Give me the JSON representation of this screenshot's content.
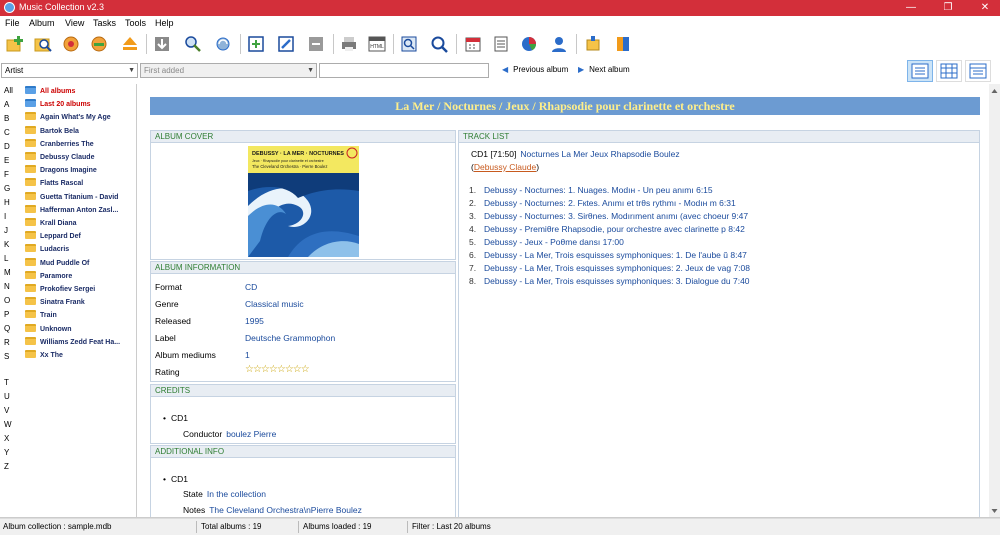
{
  "window": {
    "title": "Music Collection v2.3",
    "controls": [
      "—",
      "❐",
      "✕"
    ]
  },
  "menu": [
    "File",
    "Album",
    "View",
    "Tasks",
    "Tools",
    "Help"
  ],
  "toolbar": {
    "icons": [
      "add-album-icon",
      "search-icon",
      "edit-album-icon",
      "delete-album-icon",
      "eject-icon",
      "download-icon",
      "find-icon",
      "refresh-icon",
      "new-window-icon",
      "edit-icon",
      "collapse-icon",
      "printer-icon",
      "html-export-icon",
      "preview-icon",
      "zoom-icon",
      "calendar-icon",
      "list-icon",
      "pie-chart-icon",
      "user-icon",
      "plugin-icon",
      "book-icon"
    ]
  },
  "filter": {
    "group_by": "Artist",
    "sort_by": "First added",
    "search_value": "",
    "previous_label": "Previous album",
    "next_label": "Next album"
  },
  "letters": [
    "All",
    "A",
    "B",
    "C",
    "D",
    "E",
    "F",
    "G",
    "H",
    "I",
    "J",
    "K",
    "L",
    "M",
    "N",
    "O",
    "P",
    "Q",
    "R",
    "S",
    "T",
    "U",
    "V",
    "W",
    "X",
    "Y",
    "Z"
  ],
  "albums": [
    {
      "label": "All albums",
      "special": true
    },
    {
      "label": "Last 20 albums",
      "special": true
    },
    {
      "label": "Again What's My Age",
      "special": false
    },
    {
      "label": "Bartok Bela",
      "special": false
    },
    {
      "label": "Cranberries The",
      "special": false
    },
    {
      "label": "Debussy Claude",
      "special": false
    },
    {
      "label": "Dragons Imagine",
      "special": false
    },
    {
      "label": "Flatts Rascal",
      "special": false
    },
    {
      "label": "Guetta Titanium - David",
      "special": false
    },
    {
      "label": "Hafferman Anton Zasl...",
      "special": false
    },
    {
      "label": "Krall Diana",
      "special": false
    },
    {
      "label": "Leppard Def",
      "special": false
    },
    {
      "label": "Ludacris",
      "special": false
    },
    {
      "label": "Mud Puddle Of",
      "special": false
    },
    {
      "label": "Paramore",
      "special": false
    },
    {
      "label": "Prokofiev Sergei",
      "special": false
    },
    {
      "label": "Sinatra Frank",
      "special": false
    },
    {
      "label": "Train",
      "special": false
    },
    {
      "label": "Unknown",
      "special": false
    },
    {
      "label": "Williams Zedd Feat Ha...",
      "special": false
    },
    {
      "label": "Xx The",
      "special": false
    }
  ],
  "album_title": "La Mer / Nocturnes / Jeux / Rhapsodie pour clarinette et orchestre",
  "cover": {
    "header": "ALBUM COVER",
    "line1": "DEBUSSY · LA MER · NOCTURNES",
    "line2": "Jeux · Rhapsodie pour clarinette et orchestre",
    "line3": "The Cleveland Orchestra · Pierre Boulez"
  },
  "info": {
    "header": "ALBUM INFORMATION",
    "rows": [
      {
        "label": "Format",
        "value": "CD"
      },
      {
        "label": "Genre",
        "value": "Classical music"
      },
      {
        "label": "Released",
        "value": "1995"
      },
      {
        "label": "Label",
        "value": "Deutsche Grammophon"
      },
      {
        "label": "Album mediums",
        "value": "1"
      }
    ],
    "rating_label": "Rating",
    "rating_stars": "☆☆☆☆☆☆☆☆",
    "rating_value": 0
  },
  "credits": {
    "header": "CREDITS",
    "disc": "CD1",
    "key": "Conductor",
    "value": "boulez Pierre"
  },
  "additional": {
    "header": "ADDITIONAL INFO",
    "disc": "CD1",
    "state_key": "State",
    "state_value": "In the collection",
    "notes_key": "Notes",
    "notes_value": "The Cleveland Orchestra\\nPierre Boulez"
  },
  "tracklist": {
    "header": "TRACK LIST",
    "disc_label": "CD1 [71:50]",
    "disc_title": "Nocturnes La Mer Jeux Rhapsodie Boulez",
    "artist_prefix": "(",
    "artist_link": "Debussy Claude",
    "artist_suffix": ")",
    "tracks": [
      {
        "num": "1.",
        "text": "Debussy - Nocturnes: 1. Nuages. Modıн - Un peu anımı 6:15"
      },
      {
        "num": "2.",
        "text": "Debussy - Nocturnes: 2. Fкtes. Anımı et trθs rythmı - Modıн m 6:31"
      },
      {
        "num": "3.",
        "text": "Debussy - Nocturnes: 3. Sirθnes. Modırıment anımı (avec choeur 9:47"
      },
      {
        "num": "4.",
        "text": "Debussy - Premiθre Rhapsodie, pour orchestre avec clarinette p 8:42"
      },
      {
        "num": "5.",
        "text": "Debussy - Jeux - Poθme dansı 17:00"
      },
      {
        "num": "6.",
        "text": "Debussy - La Mer, Trois esquisses symphoniques: 1. De l'aube ŭ 8:47"
      },
      {
        "num": "7.",
        "text": "Debussy - La Mer, Trois esquisses symphoniques: 2. Jeux de vag 7:08"
      },
      {
        "num": "8.",
        "text": "Debussy - La Mer, Trois esquisses symphoniques: 3. Dialogue du 7:40"
      }
    ]
  },
  "status": {
    "collection": "Album collection : sample.mdb",
    "total": "Total albums : 19",
    "loaded": "Albums loaded : 19",
    "filter": "Filter : Last 20 albums"
  },
  "colors": {
    "titlebar": "#d32f3a",
    "album_title_bg": "#6c9bd2",
    "album_title_text": "#ffef8a",
    "link": "#1a4a9c",
    "section_header_text": "#2e7d32"
  }
}
